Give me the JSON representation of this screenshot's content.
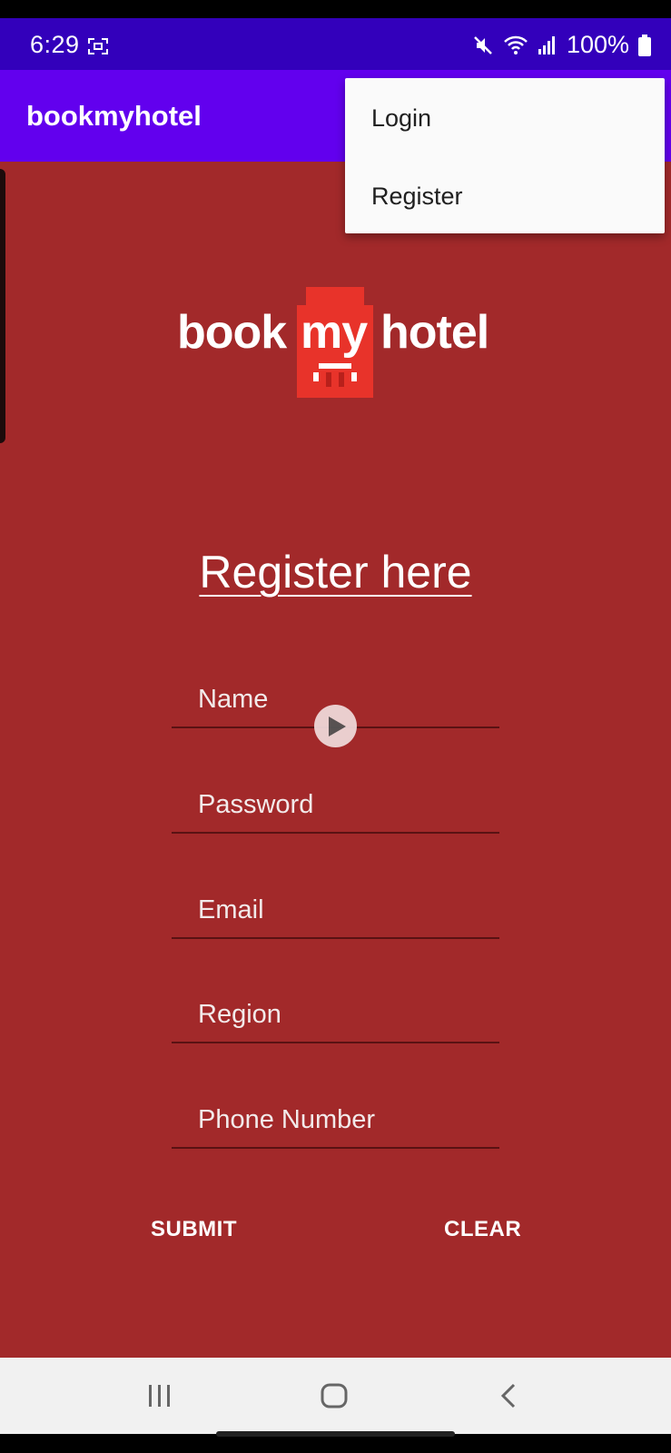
{
  "status_bar": {
    "time": "6:29",
    "battery": "100%",
    "icons": [
      "screenshot-icon",
      "mute-icon",
      "wifi-icon",
      "signal-icon",
      "battery-icon"
    ]
  },
  "app_bar": {
    "title": "bookmyhotel"
  },
  "overflow_menu": {
    "items": [
      {
        "label": "Login"
      },
      {
        "label": "Register"
      }
    ]
  },
  "logo": {
    "book": "book",
    "my": "my",
    "hotel": "hotel"
  },
  "form": {
    "heading": "Register here",
    "fields": {
      "name": {
        "placeholder": "Name",
        "value": ""
      },
      "password": {
        "placeholder": "Password",
        "value": ""
      },
      "email": {
        "placeholder": "Email",
        "value": ""
      },
      "region": {
        "placeholder": "Region",
        "value": ""
      },
      "phone": {
        "placeholder": "Phone Number",
        "value": ""
      }
    },
    "submit_label": "SUBMIT",
    "clear_label": "CLEAR"
  },
  "nav_bar": {
    "icons": [
      "recent-apps-icon",
      "home-icon",
      "back-icon"
    ]
  },
  "colors": {
    "status_bar": "#3300bb",
    "app_bar": "#6200ee",
    "background": "#a2292a",
    "logo_accent": "#e8332a",
    "menu_bg": "#fafafa"
  }
}
